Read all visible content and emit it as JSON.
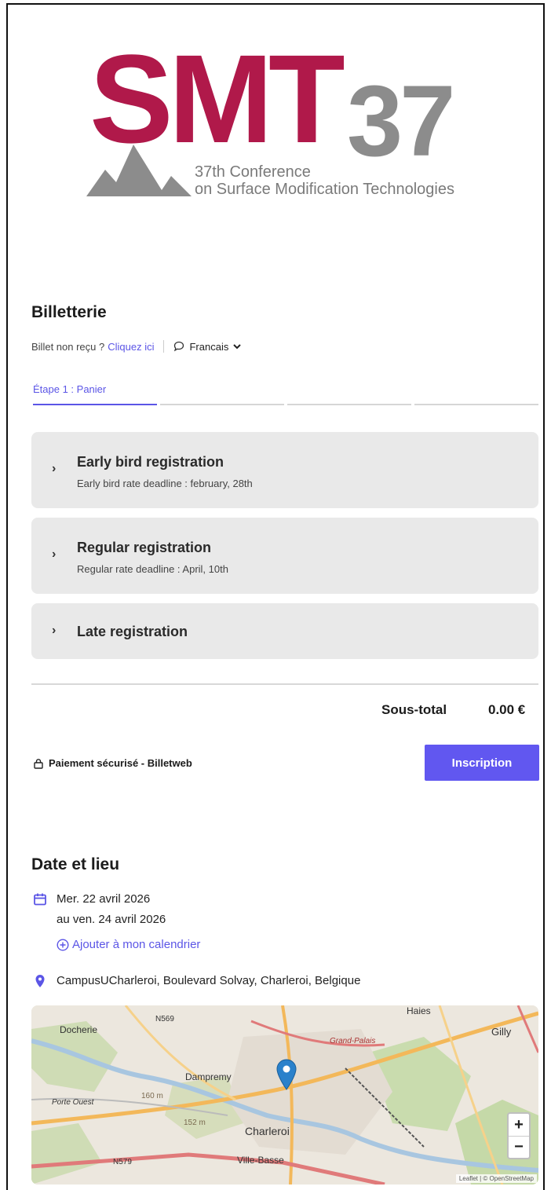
{
  "logo": {
    "title": "SMT",
    "number": "37",
    "subtitle_line1": "37th Conference",
    "subtitle_line2": "on Surface Modification Technologies"
  },
  "billetterie": {
    "title": "Billetterie",
    "not_received": "Billet non reçu ?",
    "click_here": "Cliquez ici",
    "language": "Francais",
    "step_label": "Étape 1 : Panier",
    "steps_total": 4,
    "current_step": 1
  },
  "tickets": [
    {
      "name": "Early bird registration",
      "description": "Early bird rate deadline : february, 28th"
    },
    {
      "name": "Regular registration",
      "description": "Regular rate deadline : April, 10th"
    },
    {
      "name": "Late registration",
      "description": ""
    }
  ],
  "cart": {
    "subtotal_label": "Sous-total",
    "subtotal_value": "0.00 €",
    "secure_label": "Paiement sécurisé - Billetweb",
    "register_button": "Inscription"
  },
  "event": {
    "title": "Date et lieu",
    "date_line1": "Mer. 22 avril 2026",
    "date_line2": "au ven. 24 avril 2026",
    "add_calendar": "Ajouter à mon calendrier",
    "location": "CampusUCharleroi, Boulevard Solvay, Charleroi, Belgique"
  },
  "map": {
    "labels": {
      "docherie": "Docherie",
      "n569": "N569",
      "dampremy": "Dampremy",
      "charleroi": "Charleroi",
      "ville_basse": "Ville-Basse",
      "n579": "N579",
      "gilly": "Gilly",
      "porte_ouest": "Porte Ouest",
      "grand_palais": "Grand-Palais",
      "haies": "Haies",
      "m160": "160 m",
      "m152": "152 m"
    },
    "zoom_in": "+",
    "zoom_out": "−",
    "attribution": "Leaflet | © OpenStreetMap",
    "colors": {
      "marker": "#2a81cb",
      "road_major": "#f3b85a",
      "road_red": "#e07a7a",
      "park": "#c9dcae"
    }
  },
  "colors": {
    "brand": "#b0194a",
    "gray": "#8c8c8c",
    "accent": "#5b55e6",
    "button": "#6157f0"
  }
}
